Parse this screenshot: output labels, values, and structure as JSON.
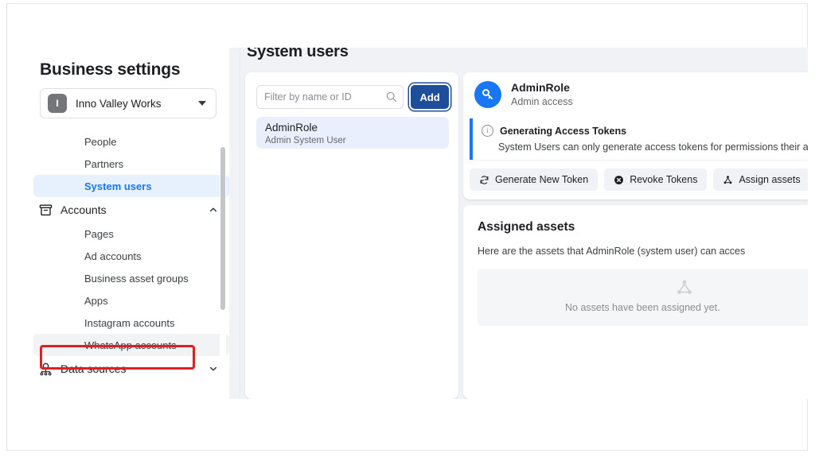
{
  "sidebar": {
    "title": "Business settings",
    "business": {
      "avatar_letter": "I",
      "name": "Inno Valley Works",
      "caret_icon": "caret-down-icon"
    },
    "items": [
      {
        "label": "People",
        "level": "sub",
        "state": "normal",
        "icon": null,
        "chevron": null
      },
      {
        "label": "Partners",
        "level": "sub",
        "state": "normal",
        "icon": null,
        "chevron": null
      },
      {
        "label": "System users",
        "level": "sub",
        "state": "active",
        "icon": null,
        "chevron": null
      },
      {
        "label": "Accounts",
        "level": "top",
        "state": "normal",
        "icon": "archive-box-icon",
        "chevron": "chevron-up-icon"
      },
      {
        "label": "Pages",
        "level": "sub",
        "state": "normal",
        "icon": null,
        "chevron": null
      },
      {
        "label": "Ad accounts",
        "level": "sub",
        "state": "normal",
        "icon": null,
        "chevron": null
      },
      {
        "label": "Business asset groups",
        "level": "sub",
        "state": "normal",
        "icon": null,
        "chevron": null
      },
      {
        "label": "Apps",
        "level": "sub",
        "state": "normal",
        "icon": null,
        "chevron": null
      },
      {
        "label": "Instagram accounts",
        "level": "sub",
        "state": "normal",
        "icon": null,
        "chevron": null
      },
      {
        "label": "WhatsApp accounts",
        "level": "sub",
        "state": "hover",
        "icon": null,
        "chevron": null
      },
      {
        "label": "Data sources",
        "level": "top",
        "state": "normal",
        "icon": "data-sources-icon",
        "chevron": "chevron-down-icon"
      }
    ],
    "annotation": {
      "target_label": "WhatsApp accounts",
      "color": "#e02020"
    }
  },
  "content": {
    "title": "System users",
    "users_panel": {
      "search": {
        "placeholder": "Filter by name or ID",
        "value": "",
        "icon": "search-icon"
      },
      "add_button": {
        "label": "Add",
        "color": "#1d4e99"
      },
      "users": [
        {
          "name": "AdminRole",
          "role": "Admin System User",
          "selected": true
        }
      ]
    },
    "detail_panel": {
      "avatar_icon": "key-icon",
      "avatar_color": "#1877f2",
      "name": "AdminRole",
      "access": "Admin access",
      "info_banner": {
        "icon": "info-circle-icon",
        "title": "Generating Access Tokens",
        "body": "System Users can only generate access tokens for permissions their ap",
        "accent_color": "#1877f2"
      },
      "actions": [
        {
          "label": "Generate New Token",
          "icon": "refresh-icon"
        },
        {
          "label": "Revoke Tokens",
          "icon": "revoke-circle-icon"
        },
        {
          "label": "Assign assets",
          "icon": "assign-assets-icon"
        }
      ]
    },
    "assets_panel": {
      "title": "Assigned assets",
      "description": "Here are the assets that AdminRole (system user) can acces",
      "empty_icon": "asset-network-icon",
      "empty_text": "No assets have been assigned yet."
    }
  }
}
